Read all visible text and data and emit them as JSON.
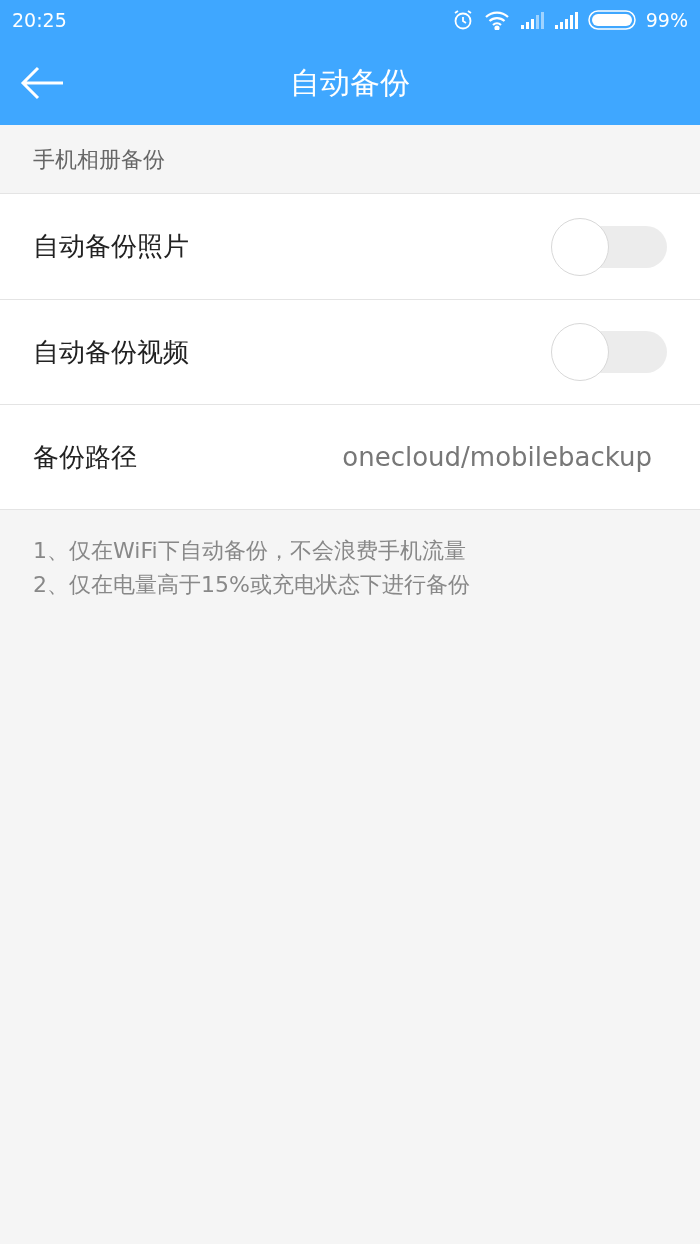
{
  "status_bar": {
    "time": "20:25",
    "battery": "99%"
  },
  "header": {
    "title": "自动备份"
  },
  "section": {
    "title": "手机相册备份"
  },
  "rows": [
    {
      "kind": "toggle",
      "label": "自动备份照片",
      "on": false
    },
    {
      "kind": "toggle",
      "label": "自动备份视频",
      "on": false
    },
    {
      "kind": "value",
      "label": "备份路径",
      "value": "onecloud/mobilebackup"
    }
  ],
  "notes": [
    "1、仅在WiFi下自动备份，不会浪费手机流量",
    "2、仅在电量高于15%或充电状态下进行备份"
  ]
}
